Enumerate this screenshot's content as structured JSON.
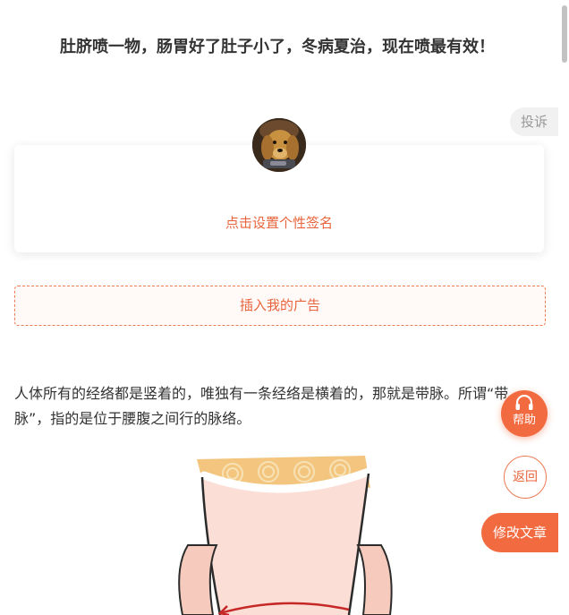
{
  "article": {
    "title": "肚脐喷一物，肠胃好了肚子小了，冬病夏治，现在喷最有效！",
    "body": "人体所有的经络都是竖着的，唯独有一条经络是横着的，那就是带脉。所谓“带脉”，指的是位于腰腹之间行的脉络。"
  },
  "profile": {
    "signature_prompt": "点击设置个性签名"
  },
  "ad": {
    "label": "插入我的广告"
  },
  "actions": {
    "complain": "投诉",
    "help": "帮助",
    "back": "返回",
    "edit": "修改文章"
  },
  "colors": {
    "accent": "#f26a3f",
    "accent_text": "#e8643c",
    "text": "#333333"
  },
  "icons": {
    "help": "headset-icon"
  }
}
